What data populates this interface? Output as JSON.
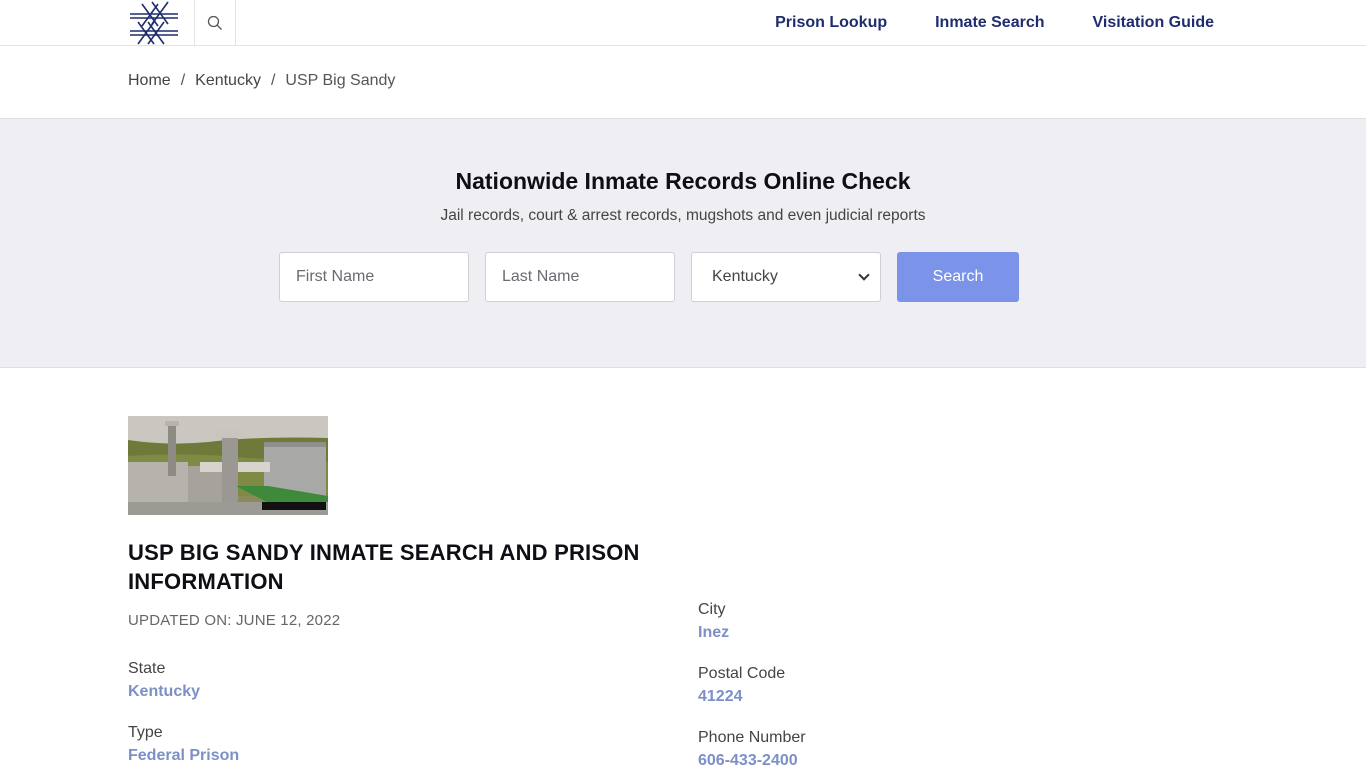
{
  "header": {
    "nav": [
      "Prison Lookup",
      "Inmate Search",
      "Visitation Guide"
    ]
  },
  "breadcrumb": {
    "home": "Home",
    "state": "Kentucky",
    "current": "USP Big Sandy",
    "separator": "/"
  },
  "hero": {
    "title": "Nationwide Inmate Records Online Check",
    "subtitle": "Jail records, court & arrest records, mugshots and even judicial reports",
    "first_name_placeholder": "First Name",
    "last_name_placeholder": "Last Name",
    "state_selected": "Kentucky",
    "search_label": "Search"
  },
  "content": {
    "title": "USP BIG SANDY INMATE SEARCH AND PRISON INFORMATION",
    "updated": "UPDATED ON: JUNE 12, 2022",
    "left": [
      {
        "label": "State",
        "value": "Kentucky"
      },
      {
        "label": "Type",
        "value": "Federal Prison"
      }
    ],
    "right": [
      {
        "label": "City",
        "value": "Inez"
      },
      {
        "label": "Postal Code",
        "value": "41224"
      },
      {
        "label": "Phone Number",
        "value": "606-433-2400"
      }
    ]
  },
  "colors": {
    "nav": "#1f2d6e",
    "accent_button": "#7b93e8",
    "value_link": "#7d90c6",
    "hero_bg": "#efeff3"
  }
}
